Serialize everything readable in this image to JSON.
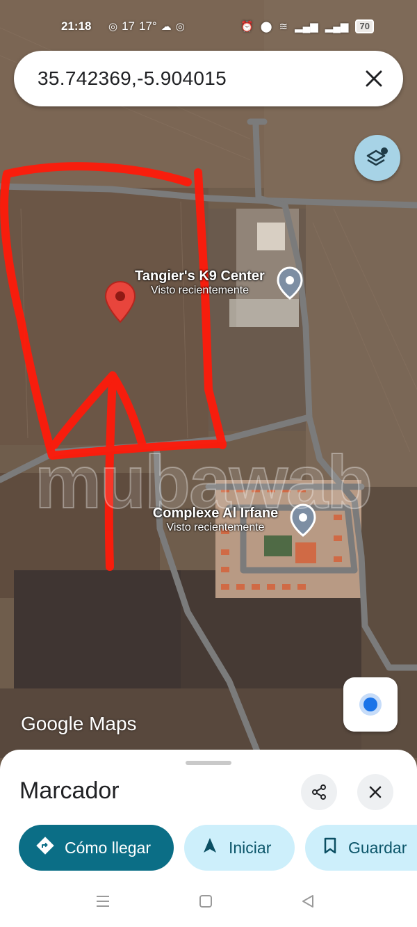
{
  "status_bar": {
    "time": "21:18",
    "left_icons": [
      "instagram-icon",
      "notification-count-icon",
      "weather-icon",
      "app-icon",
      "instagram-icon"
    ],
    "notification_count": "17",
    "temperature": "17°",
    "battery": "70"
  },
  "search": {
    "value": "35.742369,-5.904015"
  },
  "map": {
    "places": [
      {
        "title": "Tangier's K9 Center",
        "subtitle": "Visto recientemente"
      },
      {
        "title": "Complexe Al Irfane",
        "subtitle": "Visto recientemente"
      }
    ],
    "watermark": "mubawab",
    "logo": "Google Maps",
    "marker_color": "#e8453c",
    "annotation_color": "#ff1a0a"
  },
  "sheet": {
    "title": "Marcador",
    "actions": {
      "directions": "Cómo llegar",
      "start": "Iniciar",
      "save": "Guardar"
    }
  }
}
